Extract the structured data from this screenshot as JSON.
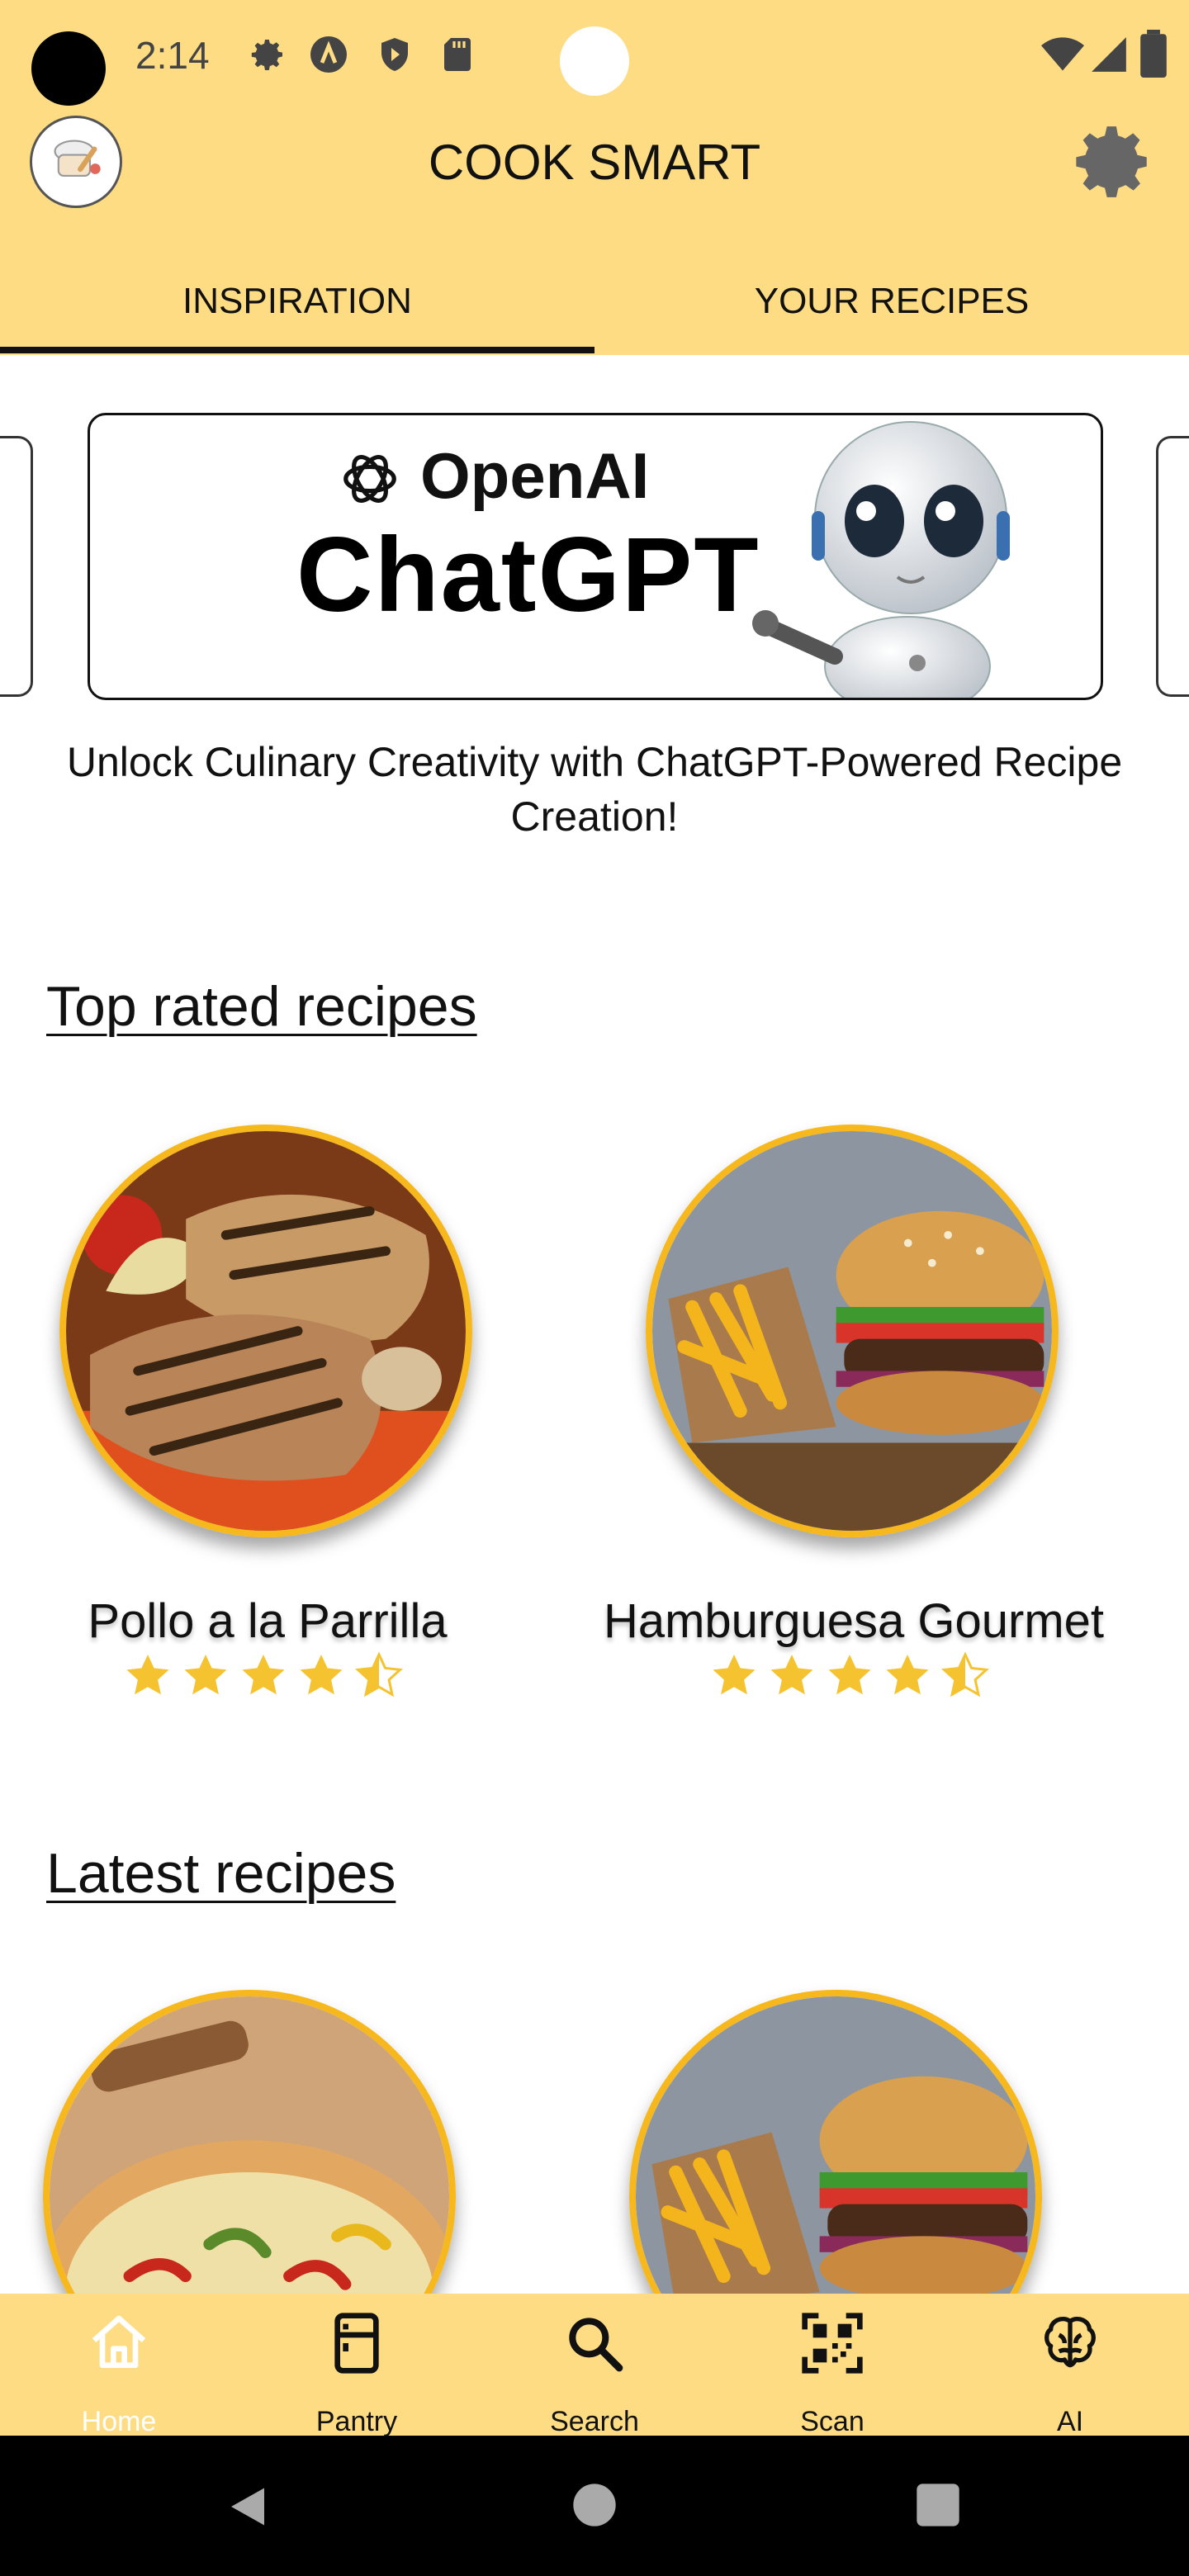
{
  "status_bar": {
    "time": "2:14"
  },
  "app_bar": {
    "title": "COOK SMART"
  },
  "tabs": [
    {
      "label": "INSPIRATION",
      "active": true
    },
    {
      "label": "YOUR RECIPES",
      "active": false
    }
  ],
  "banner": {
    "brand": "OpenAI",
    "product": "ChatGPT",
    "tagline": "Unlock Culinary Creativity with ChatGPT-Powered Recipe Creation!"
  },
  "top_rated": {
    "heading": "Top rated recipes",
    "items": [
      {
        "name": "Pollo a la Parrilla",
        "rating": 4.5
      },
      {
        "name": "Hamburguesa Gourmet",
        "rating": 4.5
      }
    ]
  },
  "latest": {
    "heading": "Latest recipes"
  },
  "bottom_nav": [
    {
      "label": "Home",
      "icon": "home-icon",
      "active": true
    },
    {
      "label": "Pantry",
      "icon": "fridge-icon",
      "active": false
    },
    {
      "label": "Search",
      "icon": "search-icon",
      "active": false
    },
    {
      "label": "Scan",
      "icon": "qr-code-icon",
      "active": false
    },
    {
      "label": "AI",
      "icon": "brain-icon",
      "active": false
    }
  ],
  "colors": {
    "accent": "#fddc84",
    "ring": "#f6b81c",
    "star": "#f5c330"
  }
}
